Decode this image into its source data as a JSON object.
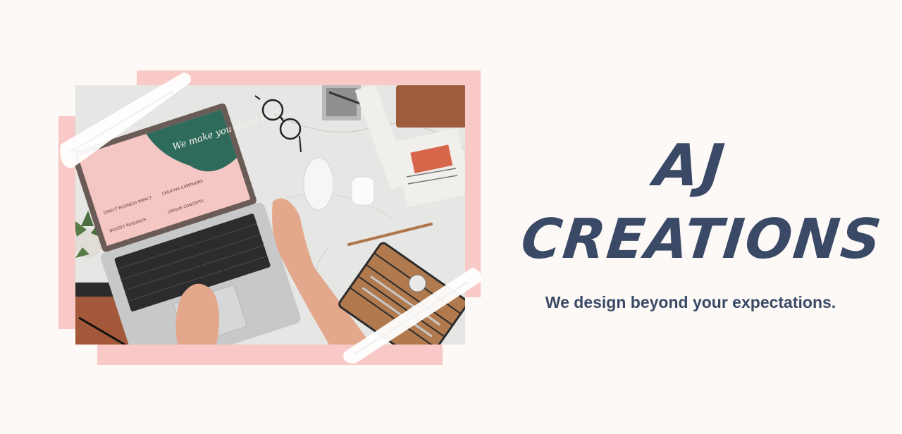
{
  "brand": {
    "line1": "AJ",
    "line2": "CREATIONS"
  },
  "tagline": "We design beyond your expectations.",
  "photo": {
    "laptop_screen": {
      "headline": "We make you stand out!",
      "items": [
        "DIRECT BUSINESS IMPACT",
        "CREATIVE CAMPAIGNS",
        "BUDGET RESEARCH",
        "UNIQUE CONCEPTS"
      ]
    }
  },
  "colors": {
    "background": "#fdf9f6",
    "accent_pink": "#f8c9c6",
    "text_navy": "#3a4a66"
  }
}
